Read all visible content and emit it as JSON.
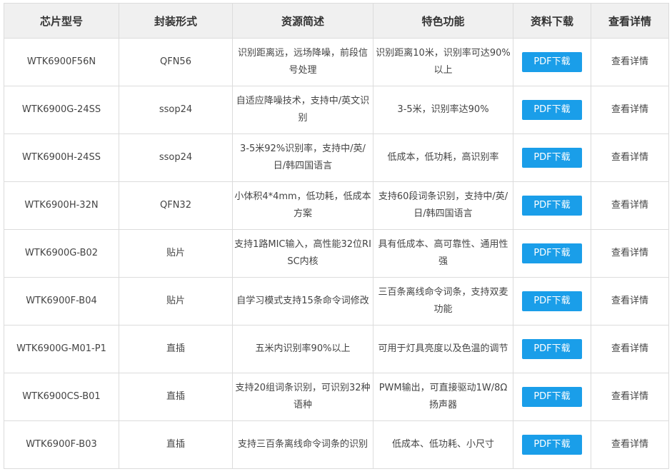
{
  "table": {
    "headers": [
      "芯片型号",
      "封装形式",
      "资源简述",
      "特色功能",
      "资料下载",
      "查看详情"
    ],
    "rows": [
      {
        "model": "WTK6900F56N",
        "package": "QFN56",
        "summary": "识别距离远，远场降噪，前段信号处理",
        "feature": "识别距离10米，识别率可达90%以上",
        "download": "PDF下载",
        "detail": "查看详情"
      },
      {
        "model": "WTK6900G-24SS",
        "package": "ssop24",
        "summary": "自适应降噪技术，支持中/英文识别",
        "feature": "3-5米，识别率达90%",
        "download": "PDF下载",
        "detail": "查看详情"
      },
      {
        "model": "WTK6900H-24SS",
        "package": "ssop24",
        "summary": "3-5米92%识别率，支持中/英/日/韩四国语言",
        "feature": "低成本，低功耗，高识别率",
        "download": "PDF下载",
        "detail": "查看详情"
      },
      {
        "model": "WTK6900H-32N",
        "package": "QFN32",
        "summary": "小体积4*4mm，低功耗，低成本方案",
        "feature": "支持60段词条识别，支持中/英/日/韩四国语言",
        "download": "PDF下载",
        "detail": "查看详情"
      },
      {
        "model": "WTK6900G-B02",
        "package": "贴片",
        "summary": "支持1路MIC输入，高性能32位RISC内核",
        "feature": "具有低成本、高可靠性、通用性强",
        "download": "PDF下载",
        "detail": "查看详情"
      },
      {
        "model": "WTK6900F-B04",
        "package": "贴片",
        "summary": "自学习模式支持15条命令词修改",
        "feature": "三百条离线命令词条，支持双麦功能",
        "download": "PDF下载",
        "detail": "查看详情"
      },
      {
        "model": "WTK6900G-M01-P1",
        "package": "直插",
        "summary": "五米内识别率90%以上",
        "feature": "可用于灯具亮度以及色温的调节",
        "download": "PDF下载",
        "detail": "查看详情"
      },
      {
        "model": "WTK6900CS-B01",
        "package": "直插",
        "summary": "支持20组词条识别，可识别32种语种",
        "feature": "PWM输出，可直接驱动1W/8Ω扬声器",
        "download": "PDF下载",
        "detail": "查看详情"
      },
      {
        "model": "WTK6900F-B03",
        "package": "直插",
        "summary": "支持三百条离线命令词条的识别",
        "feature": "低成本、低功耗、小尺寸",
        "download": "PDF下载",
        "detail": "查看详情"
      }
    ]
  },
  "colors": {
    "header_bg": "#f0f0f0",
    "border": "#dcdcdc",
    "button_bg": "#1a9ee9",
    "button_text": "#ffffff"
  }
}
